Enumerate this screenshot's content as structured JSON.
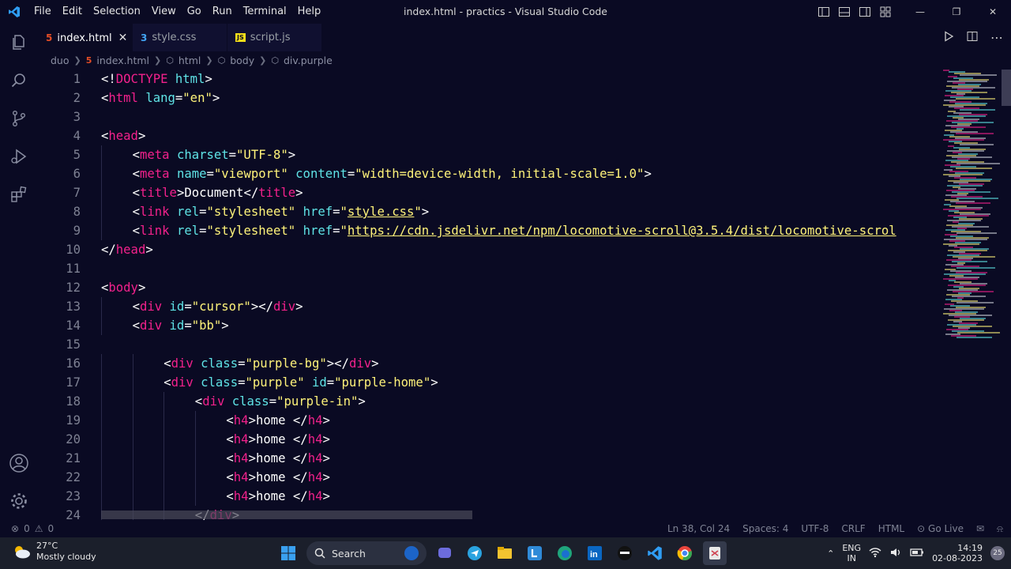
{
  "titlebar": {
    "menu": [
      "File",
      "Edit",
      "Selection",
      "View",
      "Go",
      "Run",
      "Terminal",
      "Help"
    ],
    "title": "index.html - practics - Visual Studio Code"
  },
  "tabs": [
    {
      "label": "index.html",
      "icon": "html-icon",
      "active": true
    },
    {
      "label": "style.css",
      "icon": "css-icon",
      "active": false
    },
    {
      "label": "script.js",
      "icon": "js-icon",
      "active": false
    }
  ],
  "breadcrumbs": [
    "duo",
    "index.html",
    "html",
    "body",
    "div.purple"
  ],
  "editor": {
    "lines": [
      {
        "n": "1",
        "indent": 0,
        "tokens": [
          [
            "br",
            "<!"
          ],
          [
            "tag",
            "DOCTYPE"
          ],
          [
            "br",
            " "
          ],
          [
            "attr",
            "html"
          ],
          [
            "br",
            ">"
          ]
        ]
      },
      {
        "n": "2",
        "indent": 0,
        "tokens": [
          [
            "br",
            "<"
          ],
          [
            "tag",
            "html"
          ],
          [
            "br",
            " "
          ],
          [
            "attr",
            "lang"
          ],
          [
            "br",
            "="
          ],
          [
            "str",
            "\"en\""
          ],
          [
            "br",
            ">"
          ]
        ]
      },
      {
        "n": "3",
        "indent": 0,
        "tokens": []
      },
      {
        "n": "4",
        "indent": 0,
        "tokens": [
          [
            "br",
            "<"
          ],
          [
            "tag",
            "head"
          ],
          [
            "br",
            ">"
          ]
        ]
      },
      {
        "n": "5",
        "indent": 1,
        "tokens": [
          [
            "br",
            "<"
          ],
          [
            "tag",
            "meta"
          ],
          [
            "br",
            " "
          ],
          [
            "attr",
            "charset"
          ],
          [
            "br",
            "="
          ],
          [
            "str",
            "\"UTF-8\""
          ],
          [
            "br",
            ">"
          ]
        ]
      },
      {
        "n": "6",
        "indent": 1,
        "tokens": [
          [
            "br",
            "<"
          ],
          [
            "tag",
            "meta"
          ],
          [
            "br",
            " "
          ],
          [
            "attr",
            "name"
          ],
          [
            "br",
            "="
          ],
          [
            "str",
            "\"viewport\""
          ],
          [
            "br",
            " "
          ],
          [
            "attr",
            "content"
          ],
          [
            "br",
            "="
          ],
          [
            "str",
            "\"width=device-width, initial-scale=1.0\""
          ],
          [
            "br",
            ">"
          ]
        ]
      },
      {
        "n": "7",
        "indent": 1,
        "tokens": [
          [
            "br",
            "<"
          ],
          [
            "tag",
            "title"
          ],
          [
            "br",
            ">"
          ],
          [
            "txt",
            "Document"
          ],
          [
            "br",
            "</"
          ],
          [
            "tag",
            "title"
          ],
          [
            "br",
            ">"
          ]
        ]
      },
      {
        "n": "8",
        "indent": 1,
        "tokens": [
          [
            "br",
            "<"
          ],
          [
            "tag",
            "link"
          ],
          [
            "br",
            " "
          ],
          [
            "attr",
            "rel"
          ],
          [
            "br",
            "="
          ],
          [
            "str",
            "\"stylesheet\""
          ],
          [
            "br",
            " "
          ],
          [
            "attr",
            "href"
          ],
          [
            "br",
            "="
          ],
          [
            "str",
            "\""
          ],
          [
            "link",
            "style.css"
          ],
          [
            "str",
            "\""
          ],
          [
            "br",
            ">"
          ]
        ]
      },
      {
        "n": "9",
        "indent": 1,
        "tokens": [
          [
            "br",
            "<"
          ],
          [
            "tag",
            "link"
          ],
          [
            "br",
            " "
          ],
          [
            "attr",
            "rel"
          ],
          [
            "br",
            "="
          ],
          [
            "str",
            "\"stylesheet\""
          ],
          [
            "br",
            " "
          ],
          [
            "attr",
            "href"
          ],
          [
            "br",
            "="
          ],
          [
            "str",
            "\""
          ],
          [
            "link",
            "https://cdn.jsdelivr.net/npm/locomotive-scroll@3.5.4/dist/locomotive-scrol"
          ]
        ]
      },
      {
        "n": "10",
        "indent": 0,
        "tokens": [
          [
            "br",
            "</"
          ],
          [
            "tag",
            "head"
          ],
          [
            "br",
            ">"
          ]
        ]
      },
      {
        "n": "11",
        "indent": 0,
        "tokens": []
      },
      {
        "n": "12",
        "indent": 0,
        "tokens": [
          [
            "br",
            "<"
          ],
          [
            "tag",
            "body"
          ],
          [
            "br",
            ">"
          ]
        ]
      },
      {
        "n": "13",
        "indent": 1,
        "tokens": [
          [
            "br",
            "<"
          ],
          [
            "tag",
            "div"
          ],
          [
            "br",
            " "
          ],
          [
            "attr",
            "id"
          ],
          [
            "br",
            "="
          ],
          [
            "str",
            "\"cursor\""
          ],
          [
            "br",
            "></"
          ],
          [
            "tag",
            "div"
          ],
          [
            "br",
            ">"
          ]
        ]
      },
      {
        "n": "14",
        "indent": 1,
        "tokens": [
          [
            "br",
            "<"
          ],
          [
            "tag",
            "div"
          ],
          [
            "br",
            " "
          ],
          [
            "attr",
            "id"
          ],
          [
            "br",
            "="
          ],
          [
            "str",
            "\"bb\""
          ],
          [
            "br",
            ">"
          ]
        ]
      },
      {
        "n": "15",
        "indent": 0,
        "tokens": []
      },
      {
        "n": "16",
        "indent": 2,
        "tokens": [
          [
            "br",
            "<"
          ],
          [
            "tag",
            "div"
          ],
          [
            "br",
            " "
          ],
          [
            "attr",
            "class"
          ],
          [
            "br",
            "="
          ],
          [
            "str",
            "\"purple-bg\""
          ],
          [
            "br",
            "></"
          ],
          [
            "tag",
            "div"
          ],
          [
            "br",
            ">"
          ]
        ]
      },
      {
        "n": "17",
        "indent": 2,
        "tokens": [
          [
            "br",
            "<"
          ],
          [
            "tag",
            "div"
          ],
          [
            "br",
            " "
          ],
          [
            "attr",
            "class"
          ],
          [
            "br",
            "="
          ],
          [
            "str",
            "\"purple\""
          ],
          [
            "br",
            " "
          ],
          [
            "attr",
            "id"
          ],
          [
            "br",
            "="
          ],
          [
            "str",
            "\"purple-home\""
          ],
          [
            "br",
            ">"
          ]
        ]
      },
      {
        "n": "18",
        "indent": 3,
        "tokens": [
          [
            "br",
            "<"
          ],
          [
            "tag",
            "div"
          ],
          [
            "br",
            " "
          ],
          [
            "attr",
            "class"
          ],
          [
            "br",
            "="
          ],
          [
            "str",
            "\"purple-in\""
          ],
          [
            "br",
            ">"
          ]
        ]
      },
      {
        "n": "19",
        "indent": 4,
        "tokens": [
          [
            "br",
            "<"
          ],
          [
            "tag",
            "h4"
          ],
          [
            "br",
            ">"
          ],
          [
            "txt",
            "home "
          ],
          [
            "br",
            "</"
          ],
          [
            "tag",
            "h4"
          ],
          [
            "br",
            ">"
          ]
        ]
      },
      {
        "n": "20",
        "indent": 4,
        "tokens": [
          [
            "br",
            "<"
          ],
          [
            "tag",
            "h4"
          ],
          [
            "br",
            ">"
          ],
          [
            "txt",
            "home "
          ],
          [
            "br",
            "</"
          ],
          [
            "tag",
            "h4"
          ],
          [
            "br",
            ">"
          ]
        ]
      },
      {
        "n": "21",
        "indent": 4,
        "tokens": [
          [
            "br",
            "<"
          ],
          [
            "tag",
            "h4"
          ],
          [
            "br",
            ">"
          ],
          [
            "txt",
            "home "
          ],
          [
            "br",
            "</"
          ],
          [
            "tag",
            "h4"
          ],
          [
            "br",
            ">"
          ]
        ]
      },
      {
        "n": "22",
        "indent": 4,
        "tokens": [
          [
            "br",
            "<"
          ],
          [
            "tag",
            "h4"
          ],
          [
            "br",
            ">"
          ],
          [
            "txt",
            "home "
          ],
          [
            "br",
            "</"
          ],
          [
            "tag",
            "h4"
          ],
          [
            "br",
            ">"
          ]
        ]
      },
      {
        "n": "23",
        "indent": 4,
        "tokens": [
          [
            "br",
            "<"
          ],
          [
            "tag",
            "h4"
          ],
          [
            "br",
            ">"
          ],
          [
            "txt",
            "home "
          ],
          [
            "br",
            "</"
          ],
          [
            "tag",
            "h4"
          ],
          [
            "br",
            ">"
          ]
        ]
      },
      {
        "n": "24",
        "indent": 3,
        "tokens": [
          [
            "br",
            "</"
          ],
          [
            "tag",
            "div"
          ],
          [
            "br",
            ">"
          ]
        ]
      }
    ]
  },
  "statusbar": {
    "errors": "0",
    "warnings": "0",
    "position": "Ln 38, Col 24",
    "spaces": "Spaces: 4",
    "encoding": "UTF-8",
    "eol": "CRLF",
    "language": "HTML",
    "golive": "Go Live"
  },
  "taskbar": {
    "temperature": "27°C",
    "weather": "Mostly cloudy",
    "search_label": "Search",
    "lang_top": "ENG",
    "lang_bottom": "IN",
    "time": "14:19",
    "date": "02-08-2023",
    "notification_count": "25"
  },
  "colors": {
    "background": "#0a0a23",
    "tag": "#f3218c",
    "attribute": "#5fe3e6",
    "string": "#fff37a",
    "bracket": "#ffffff",
    "accent": "#007acc"
  }
}
